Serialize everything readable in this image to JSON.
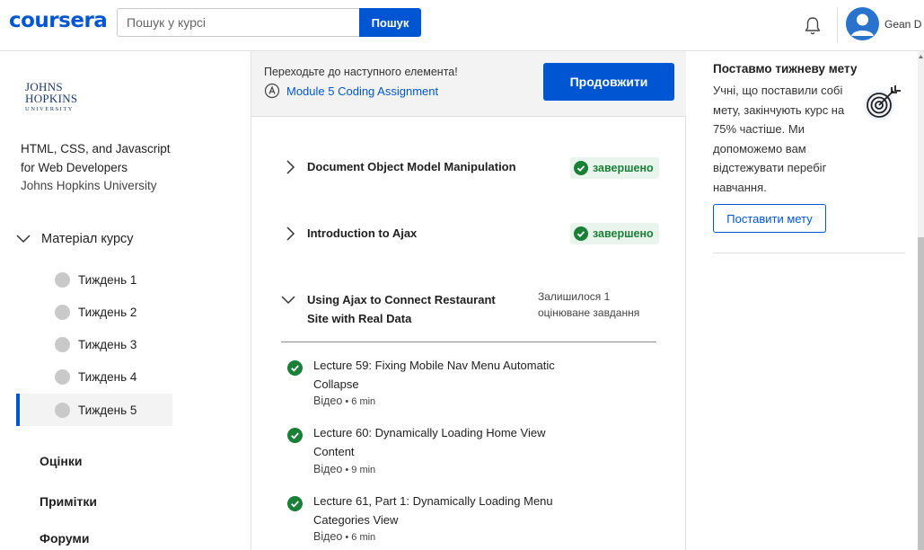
{
  "header": {
    "logo": "coursera",
    "search_placeholder": "Пошук у курсі",
    "search_button": "Пошук",
    "bell_icon": "bell-icon",
    "user_name": "Gean D"
  },
  "sidebar": {
    "org_logo": {
      "line1": "JOHNS",
      "line2": "HOPKINS",
      "line3": "UNIVERSITY"
    },
    "course_title": "HTML, CSS, and Javascript for Web Developers",
    "course_org": "Johns Hopkins University",
    "materials_label": "Матеріал курсу",
    "weeks": [
      {
        "label": "Тиждень 1",
        "active": false
      },
      {
        "label": "Тиждень 2",
        "active": false
      },
      {
        "label": "Тиждень 3",
        "active": false
      },
      {
        "label": "Тиждень 4",
        "active": false
      },
      {
        "label": "Тиждень 5",
        "active": true
      }
    ],
    "links": [
      "Оцінки",
      "Примітки",
      "Форуми"
    ]
  },
  "center": {
    "next_caption": "Переходьте до наступного елемента!",
    "next_item": "Module 5 Coding Assignment",
    "continue_button": "Продовжити",
    "modules": [
      {
        "title": "Document Object Model Manipulation",
        "status": "завершено",
        "expanded": false
      },
      {
        "title": "Introduction to Ajax",
        "status": "завершено",
        "expanded": false
      },
      {
        "title_line1": "Using Ajax to Connect Restaurant",
        "title_line2": "Site with Real Data",
        "remaining_line1": "Залишилося 1",
        "remaining_line2": "оцінюване завдання",
        "expanded": true
      }
    ],
    "lectures": [
      {
        "line1": "Lecture 59: Fixing Mobile Nav Menu Automatic",
        "line2": "Collapse",
        "type": "Відео",
        "sep": " • ",
        "duration": "6 min"
      },
      {
        "line1": "Lecture 60: Dynamically Loading Home View",
        "line2": "Content",
        "type": "Відео",
        "sep": " • ",
        "duration": "9 min"
      },
      {
        "line1": "Lecture 61, Part 1: Dynamically Loading Menu",
        "line2": "Categories View",
        "type": "Відео",
        "sep": " • ",
        "duration": "6 min"
      }
    ]
  },
  "right": {
    "goal_title": "Поставмо тижневу мету",
    "goal_text": "Учні, що поставили собі мету, закінчують курс на 75% частіше. Ми допоможемо вам відстежувати перебіг навчання.",
    "goal_button": "Поставити мету",
    "goal_icon": "target-icon"
  },
  "colors": {
    "brand": "#0056d2",
    "success": "#1a7f37",
    "success_bg": "#e8f4ec"
  }
}
